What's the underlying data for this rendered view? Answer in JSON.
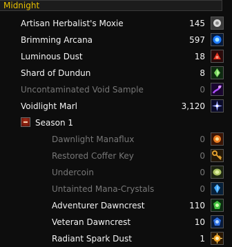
{
  "header": {
    "title": "Midnight"
  },
  "items": [
    {
      "name": "Artisan Herbalist's Moxie",
      "count": "145",
      "icon": "moxie-icon",
      "active": true
    },
    {
      "name": "Brimming Arcana",
      "count": "597",
      "icon": "arcana-orb-icon",
      "active": true
    },
    {
      "name": "Luminous Dust",
      "count": "18",
      "icon": "dust-icon",
      "active": true
    },
    {
      "name": "Shard of Dundun",
      "count": "8",
      "icon": "green-shard-icon",
      "active": true
    },
    {
      "name": "Uncontaminated Void Sample",
      "count": "0",
      "icon": "void-sample-icon",
      "active": false
    },
    {
      "name": "Voidlight Marl",
      "count": "3,120",
      "icon": "crystal-star-icon",
      "active": true
    }
  ],
  "group": {
    "label": "Season 1",
    "items": [
      {
        "name": "Dawnlight Manaflux",
        "count": "0",
        "icon": "manaflux-icon",
        "active": false
      },
      {
        "name": "Restored Coffer Key",
        "count": "0",
        "icon": "key-icon",
        "active": false
      },
      {
        "name": "Undercoin",
        "count": "0",
        "icon": "coin-icon",
        "active": false
      },
      {
        "name": "Untainted Mana-Crystals",
        "count": "0",
        "icon": "mana-crystal-icon",
        "active": false
      },
      {
        "name": "Adventurer Dawncrest",
        "count": "110",
        "icon": "green-crest-icon",
        "active": true
      },
      {
        "name": "Veteran Dawncrest",
        "count": "10",
        "icon": "blue-crest-icon",
        "active": true
      },
      {
        "name": "Radiant Spark Dust",
        "count": "1",
        "icon": "spark-icon",
        "active": true
      }
    ]
  },
  "colors": {
    "header_text": "#e8c000",
    "active_text": "#f4f4f4",
    "inactive_text": "#777777"
  }
}
